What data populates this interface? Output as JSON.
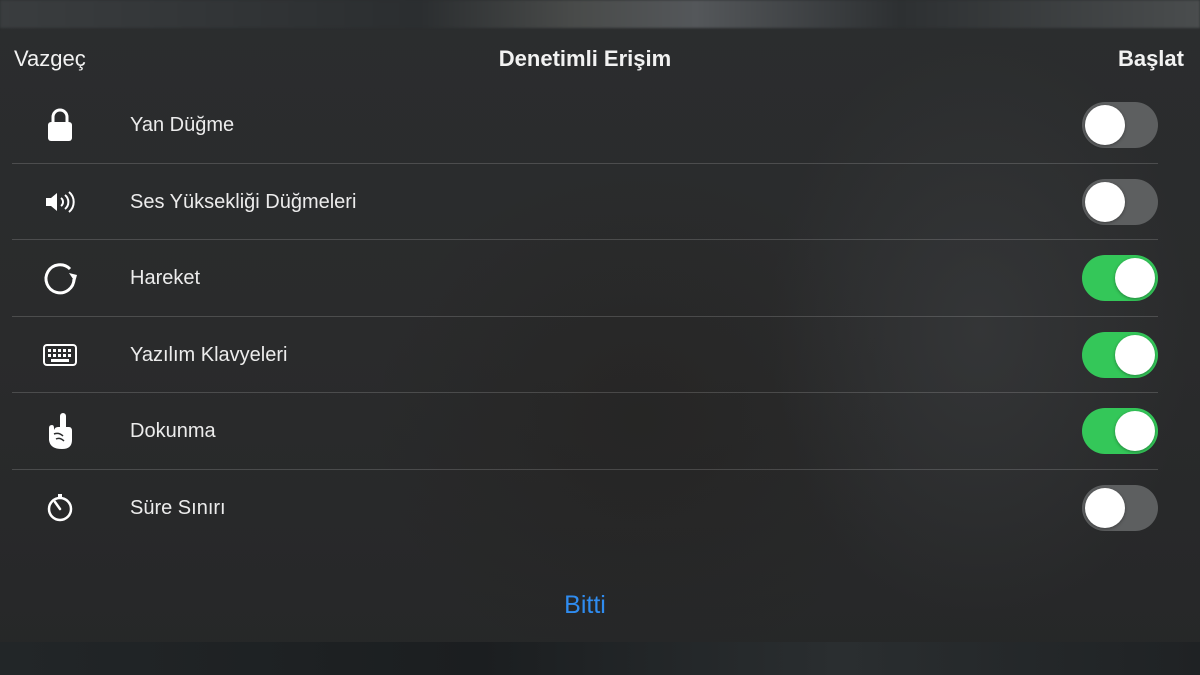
{
  "header": {
    "cancel_label": "Vazgeç",
    "title": "Denetimli Erişim",
    "start_label": "Başlat"
  },
  "options": [
    {
      "icon": "lock-icon",
      "label": "Yan Düğme",
      "enabled": false
    },
    {
      "icon": "volume-icon",
      "label": "Ses Yüksekliği Düğmeleri",
      "enabled": false
    },
    {
      "icon": "rotate-icon",
      "label": "Hareket",
      "enabled": true
    },
    {
      "icon": "keyboard-icon",
      "label": "Yazılım Klavyeleri",
      "enabled": true
    },
    {
      "icon": "touch-hand-icon",
      "label": "Dokunma",
      "enabled": true
    },
    {
      "icon": "timer-icon",
      "label": "Süre Sınırı",
      "enabled": false
    }
  ],
  "footer": {
    "done_label": "Bitti"
  },
  "colors": {
    "toggle_on": "#34c759",
    "toggle_off": "#5d5f60",
    "accent": "#2f8cf0"
  }
}
